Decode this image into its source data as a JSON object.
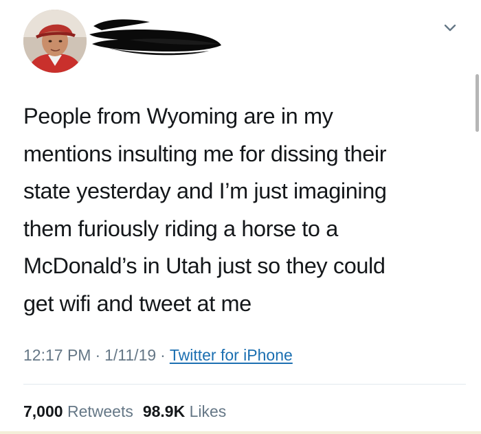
{
  "tweet": {
    "text_lines": [
      "People from Wyoming are in my",
      "mentions insulting me for dissing their",
      "state yesterday and I’m just imagining",
      "them furiously riding a horse to a",
      "McDonald’s in Utah just so they could",
      "get wifi and tweet at me"
    ],
    "time": "12:17 PM",
    "separator": "·",
    "date": "1/11/19",
    "source": "Twitter for iPhone",
    "retweets_count": "7,000",
    "retweets_label": "Retweets",
    "likes_count": "98.9K",
    "likes_label": "Likes"
  },
  "icons": {
    "menu": "chevron-down-icon",
    "avatar": "avatar"
  },
  "colors": {
    "text": "#14171a",
    "secondary": "#657786",
    "link": "#1b6fb1",
    "divider": "#e1e8ed"
  }
}
